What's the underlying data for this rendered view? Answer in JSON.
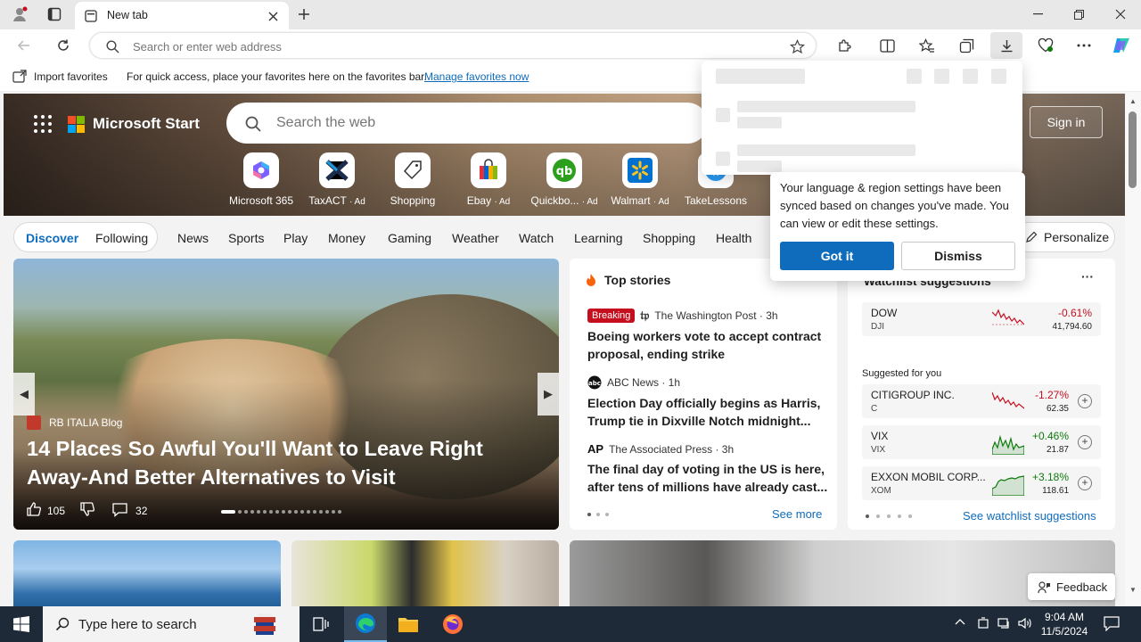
{
  "browser": {
    "tab_title": "New tab",
    "address_placeholder": "Search or enter web address"
  },
  "favorites_bar": {
    "import_label": "Import favorites",
    "message": "For quick access, place your favorites here on the favorites bar.",
    "manage_link": "Manage favorites now"
  },
  "msstart": {
    "brand": "Microsoft Start",
    "search_placeholder": "Search the web",
    "signin": "Sign in",
    "shortcuts": [
      {
        "label": "Microsoft 365",
        "ad": ""
      },
      {
        "label": "TaxACT",
        "ad": "· Ad"
      },
      {
        "label": "Shopping",
        "ad": ""
      },
      {
        "label": "Ebay",
        "ad": "· Ad"
      },
      {
        "label": "Quickbo...",
        "ad": "· Ad"
      },
      {
        "label": "Walmart",
        "ad": "· Ad"
      },
      {
        "label": "TakeLessons",
        "ad": ""
      }
    ]
  },
  "nav": {
    "discover": "Discover",
    "following": "Following",
    "items": [
      "News",
      "Sports",
      "Play",
      "Money",
      "Gaming",
      "Weather",
      "Watch",
      "Learning",
      "Shopping",
      "Health"
    ],
    "personalize": "Personalize"
  },
  "feature": {
    "source": "RB ITALIA Blog",
    "title": "14 Places So Awful You'll Want to Leave Right Away-And Better Alternatives to Visit",
    "likes": "105",
    "comments": "32"
  },
  "top_stories": {
    "heading": "Top stories",
    "stories": [
      {
        "badge": "Breaking",
        "source": "The Washington Post · 3h",
        "title": "Boeing workers vote to accept contract proposal, ending strike"
      },
      {
        "badge": "",
        "source": "ABC News · 1h",
        "title": "Election Day officially begins as Harris, Trump tie in Dixville Notch midnight..."
      },
      {
        "badge": "",
        "source": "The Associated Press · 3h",
        "title": "The final day of voting in the US is here, after tens of millions have already cast..."
      }
    ],
    "see_more": "See more"
  },
  "watchlist": {
    "heading": "Watchlist suggestions",
    "more": "···",
    "suggested_label": "Suggested for you",
    "stocks": [
      {
        "name": "DOW",
        "symbol": "DJI",
        "change": "-0.61%",
        "price": "41,794.60",
        "trend": "down"
      },
      {
        "name": "CITIGROUP INC.",
        "symbol": "C",
        "change": "-1.27%",
        "price": "62.35",
        "trend": "down"
      },
      {
        "name": "VIX",
        "symbol": "VIX",
        "change": "+0.46%",
        "price": "21.87",
        "trend": "up"
      },
      {
        "name": "EXXON MOBIL CORP...",
        "symbol": "XOM",
        "change": "+3.18%",
        "price": "118.61",
        "trend": "up"
      }
    ],
    "see_link": "See watchlist suggestions"
  },
  "popup": {
    "text": "Your language & region settings have been synced based on changes you've made. You can view or edit these settings.",
    "got_it": "Got it",
    "dismiss": "Dismiss"
  },
  "feedback": "Feedback",
  "taskbar": {
    "search_placeholder": "Type here to search",
    "time": "9:04 AM",
    "date": "11/5/2024"
  },
  "colors": {
    "accent": "#0f6cbd",
    "negative": "#c50f1f",
    "positive": "#0e7a0d",
    "taskbar": "#1f2a38"
  }
}
